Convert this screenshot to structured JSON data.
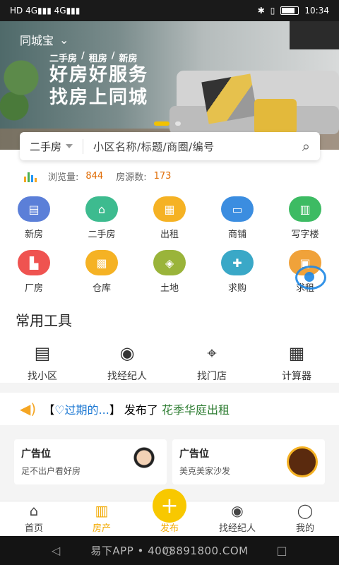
{
  "status": {
    "left_icons": "HD  4G▮▮▮ 4G▮▮▮",
    "time": "10:34"
  },
  "hero": {
    "city": "同城宝",
    "tags": [
      "二手房",
      "/",
      "租房",
      "/",
      "新房"
    ],
    "title_line1": "好房好服务",
    "title_line2": "找房上同城"
  },
  "search": {
    "type": "二手房",
    "placeholder": "小区名称/标题/商圈/编号"
  },
  "stats": {
    "views_label": "浏览量:",
    "views": "844",
    "listings_label": "房源数:",
    "listings": "173"
  },
  "categories": [
    {
      "label": "新房",
      "color": "#5b7fd8",
      "icon": "▤"
    },
    {
      "label": "二手房",
      "color": "#3dbb8f",
      "icon": "⌂"
    },
    {
      "label": "出租",
      "color": "#f5b224",
      "icon": "▦"
    },
    {
      "label": "商铺",
      "color": "#3b8de0",
      "icon": "▭"
    },
    {
      "label": "写字楼",
      "color": "#3dbb63",
      "icon": "▥"
    },
    {
      "label": "厂房",
      "color": "#ef5350",
      "icon": "▙"
    },
    {
      "label": "仓库",
      "color": "#f5b224",
      "icon": "▩"
    },
    {
      "label": "土地",
      "color": "#9ab43a",
      "icon": "◈"
    },
    {
      "label": "求购",
      "color": "#3aa8c7",
      "icon": "✚"
    },
    {
      "label": "求租",
      "color": "#f0a23a",
      "icon": "▣"
    }
  ],
  "tools": {
    "title": "常用工具",
    "items": [
      {
        "label": "找小区",
        "icon": "▤"
      },
      {
        "label": "找经纪人",
        "icon": "◉"
      },
      {
        "label": "找门店",
        "icon": "⌖"
      },
      {
        "label": "计算器",
        "icon": "▦"
      }
    ]
  },
  "notice": {
    "bracket_open": "【",
    "user": "♡过期的...",
    "bracket_close": "】",
    "action": "发布了",
    "target": "花季华庭出租"
  },
  "ads": [
    {
      "title": "广告位",
      "subtitle": "足不出户看好房"
    },
    {
      "title": "广告位",
      "subtitle": "美克美家沙发"
    }
  ],
  "tabbar": [
    {
      "label": "首页",
      "icon": "⌂"
    },
    {
      "label": "房产",
      "icon": "▥"
    },
    {
      "label": "发布",
      "icon": "+"
    },
    {
      "label": "找经纪人",
      "icon": "◉"
    },
    {
      "label": "我的",
      "icon": "◯"
    }
  ],
  "navbar": {
    "watermark": "易下APP • 4008891800.COM"
  },
  "colors": {
    "accent": "#f2c200",
    "orange_num": "#e06a00"
  }
}
